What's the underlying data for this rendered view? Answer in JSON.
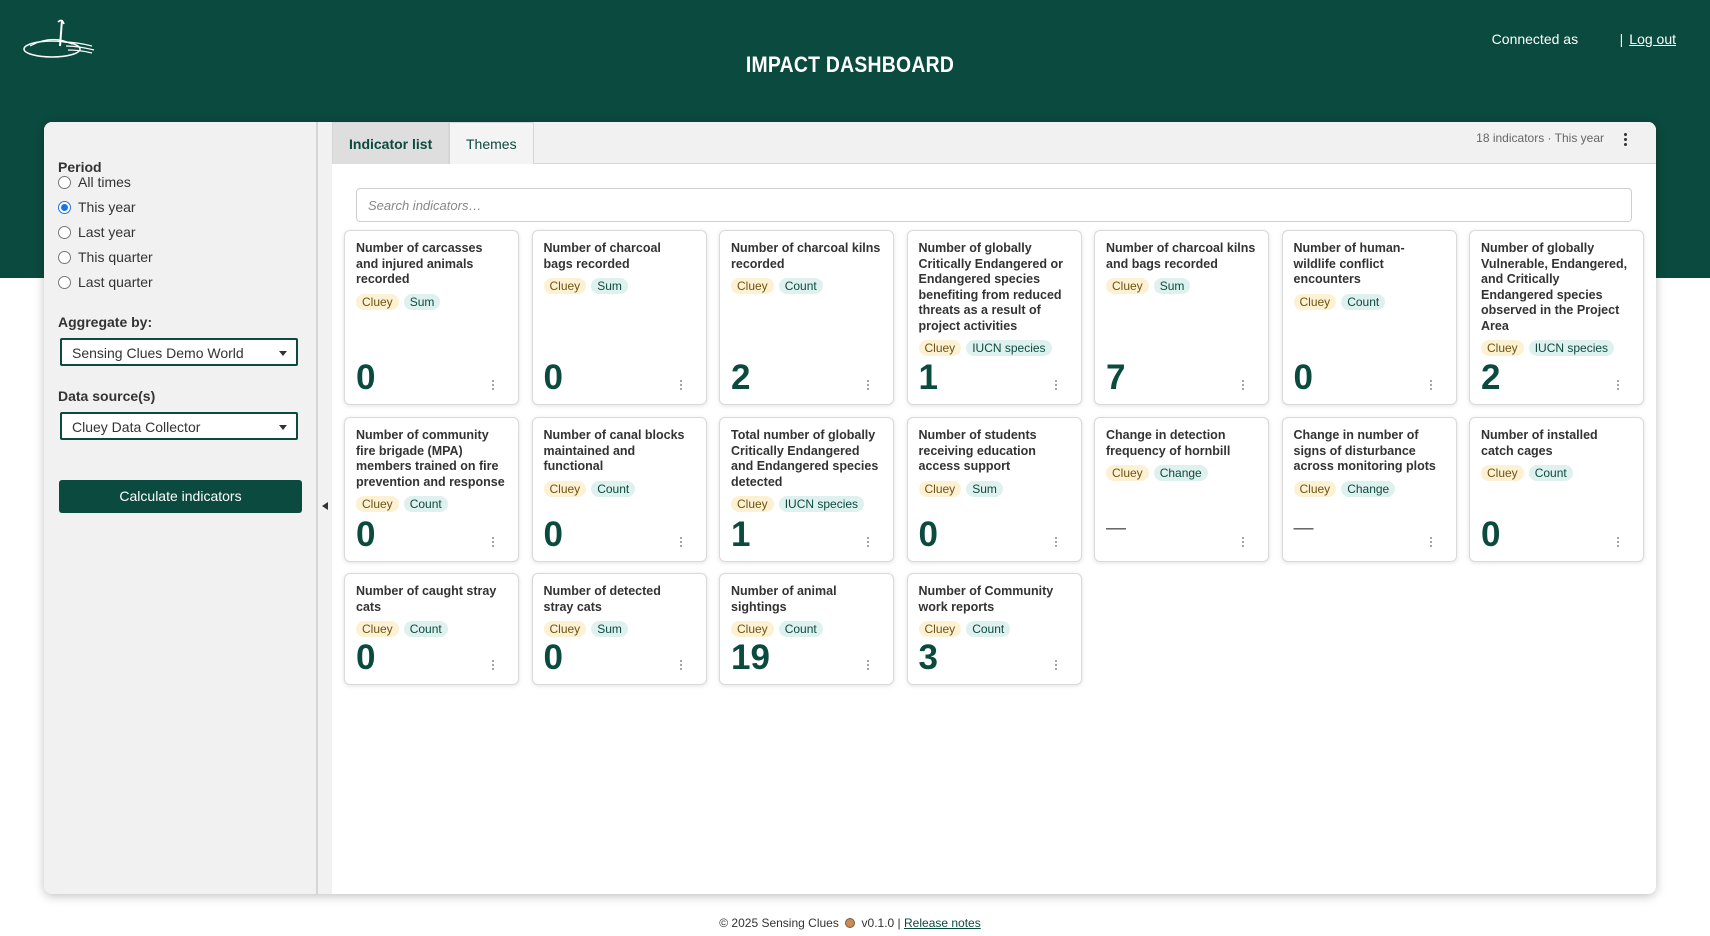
{
  "app": {
    "title": "IMPACT DASHBOARD",
    "connected_as": "Connected as",
    "separator": "|",
    "logout": "Log out"
  },
  "sidebar": {
    "period_label": "Period",
    "period_options": [
      {
        "label": "All times",
        "checked": false
      },
      {
        "label": "This year",
        "checked": true
      },
      {
        "label": "Last year",
        "checked": false
      },
      {
        "label": "This quarter",
        "checked": false
      },
      {
        "label": "Last quarter",
        "checked": false
      }
    ],
    "aggregate_label": "Aggregate by:",
    "aggregate_value": "Sensing Clues Demo World",
    "datasource_label": "Data source(s)",
    "datasource_value": "Cluey Data Collector",
    "calculate_button": "Calculate indicators"
  },
  "main": {
    "tabs": [
      "Indicator list",
      "Themes"
    ],
    "meta": "18 indicators · This year",
    "search_placeholder": "Search indicators…"
  },
  "cards": [
    {
      "title": "Number of carcasses and injured animals recorded",
      "source": "Cluey",
      "kind": "Sum",
      "value": "0"
    },
    {
      "title": "Number of charcoal bags recorded",
      "source": "Cluey",
      "kind": "Sum",
      "value": "0"
    },
    {
      "title": "Number of charcoal kilns recorded",
      "source": "Cluey",
      "kind": "Count",
      "value": "2"
    },
    {
      "title": "Number of globally Critically Endangered or Endangered species benefiting from reduced threats as a result of project activities",
      "source": "Cluey",
      "kind": "IUCN species",
      "value": "1"
    },
    {
      "title": "Number of charcoal kilns and bags recorded",
      "source": "Cluey",
      "kind": "Sum",
      "value": "7"
    },
    {
      "title": "Number of human-wildlife conflict encounters",
      "source": "Cluey",
      "kind": "Count",
      "value": "0"
    },
    {
      "title": "Number of globally Vulnerable, Endangered, and Critically Endangered species observed in the Project Area",
      "source": "Cluey",
      "kind": "IUCN species",
      "value": "2"
    },
    {
      "title": "Number of community fire brigade (MPA) members trained on fire prevention and response",
      "source": "Cluey",
      "kind": "Count",
      "value": "0"
    },
    {
      "title": "Number of canal blocks maintained and functional",
      "source": "Cluey",
      "kind": "Count",
      "value": "0"
    },
    {
      "title": "Total number of globally Critically Endangered and Endangered species detected",
      "source": "Cluey",
      "kind": "IUCN species",
      "value": "1"
    },
    {
      "title": "Number of students receiving education access support",
      "source": "Cluey",
      "kind": "Sum",
      "value": "0"
    },
    {
      "title": "Change in detection frequency of hornbill",
      "source": "Cluey",
      "kind": "Change",
      "value": "—"
    },
    {
      "title": "Change in number of signs of disturbance across monitoring plots",
      "source": "Cluey",
      "kind": "Change",
      "value": "—"
    },
    {
      "title": "Number of installed catch cages",
      "source": "Cluey",
      "kind": "Count",
      "value": "0"
    },
    {
      "title": "Number of caught stray cats",
      "source": "Cluey",
      "kind": "Count",
      "value": "0"
    },
    {
      "title": "Number of detected stray cats",
      "source": "Cluey",
      "kind": "Sum",
      "value": "0"
    },
    {
      "title": "Number of animal sightings",
      "source": "Cluey",
      "kind": "Count",
      "value": "19"
    },
    {
      "title": "Number of Community work reports",
      "source": "Cluey",
      "kind": "Count",
      "value": "3"
    }
  ],
  "footer": {
    "copyright": "© 2025 Sensing Clues",
    "version": "v0.1.0 |",
    "release_notes": "Release notes"
  }
}
